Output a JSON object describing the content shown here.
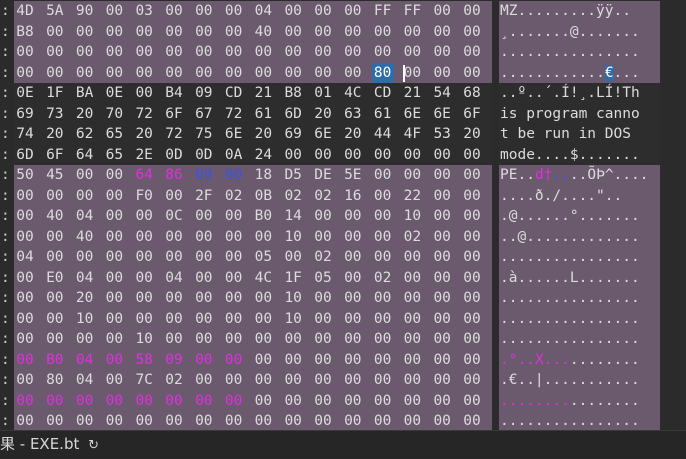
{
  "colors": {
    "header_region": "#6b5a6e",
    "plain_region": "#2d2d2d",
    "dark_text": "#dcdcdc",
    "magenta": "#e02fe0",
    "blue": "#3a52e8",
    "cursor": "#2f6da8",
    "ascii_magenta": "#e02fe0"
  },
  "header_strip": " 0  1  2  3  4  5  6  7  8  9  A  B  C  D  E  F   0123456789ABCDEF",
  "rows": [
    {
      "bytes": [
        "4D",
        "5A",
        "90",
        "00",
        "03",
        "00",
        "00",
        "00",
        "04",
        "00",
        "00",
        "00",
        "FF",
        "FF",
        "00",
        "00"
      ],
      "ascii": "MZ.........ÿÿ..",
      "bg": "struct"
    },
    {
      "bytes": [
        "B8",
        "00",
        "00",
        "00",
        "00",
        "00",
        "00",
        "00",
        "40",
        "00",
        "00",
        "00",
        "00",
        "00",
        "00",
        "00"
      ],
      "ascii": "¸.......@.......",
      "bg": "struct"
    },
    {
      "bytes": [
        "00",
        "00",
        "00",
        "00",
        "00",
        "00",
        "00",
        "00",
        "00",
        "00",
        "00",
        "00",
        "00",
        "00",
        "00",
        "00"
      ],
      "ascii": "................",
      "bg": "struct"
    },
    {
      "bytes": [
        "00",
        "00",
        "00",
        "00",
        "00",
        "00",
        "00",
        "00",
        "00",
        "00",
        "00",
        "00",
        "80",
        "00",
        "00",
        "00"
      ],
      "ascii": "............€...",
      "bg": "struct",
      "cursor_byte": 12
    },
    {
      "bytes": [
        "0E",
        "1F",
        "BA",
        "0E",
        "00",
        "B4",
        "09",
        "CD",
        "21",
        "B8",
        "01",
        "4C",
        "CD",
        "21",
        "54",
        "68"
      ],
      "ascii": "..º..´.Í!¸.LÍ!Th",
      "bg": "plain"
    },
    {
      "bytes": [
        "69",
        "73",
        "20",
        "70",
        "72",
        "6F",
        "67",
        "72",
        "61",
        "6D",
        "20",
        "63",
        "61",
        "6E",
        "6E",
        "6F"
      ],
      "ascii": "is program canno",
      "bg": "plain"
    },
    {
      "bytes": [
        "74",
        "20",
        "62",
        "65",
        "20",
        "72",
        "75",
        "6E",
        "20",
        "69",
        "6E",
        "20",
        "44",
        "4F",
        "53",
        "20"
      ],
      "ascii": "t be run in DOS ",
      "bg": "plain"
    },
    {
      "bytes": [
        "6D",
        "6F",
        "64",
        "65",
        "2E",
        "0D",
        "0D",
        "0A",
        "24",
        "00",
        "00",
        "00",
        "00",
        "00",
        "00",
        "00"
      ],
      "ascii": "mode....$.......",
      "bg": "plain"
    },
    {
      "bytes": [
        "50",
        "45",
        "00",
        "00",
        "64",
        "86",
        "09",
        "00",
        "18",
        "D5",
        "DE",
        "5E",
        "00",
        "00",
        "00",
        "00"
      ],
      "ascii": "PE..d†....ÕÞ^....",
      "bg": "struct",
      "colors": {
        "4": "magenta",
        "5": "magenta",
        "6": "blue",
        "7": "blue"
      },
      "ascii_colors": {
        "4": "magenta",
        "5": "magenta",
        "6": "blue",
        "7": "blue"
      }
    },
    {
      "bytes": [
        "00",
        "00",
        "00",
        "00",
        "F0",
        "00",
        "2F",
        "02",
        "0B",
        "02",
        "02",
        "16",
        "00",
        "22",
        "00",
        "00"
      ],
      "ascii": "....ð./....\"..",
      "bg": "struct"
    },
    {
      "bytes": [
        "00",
        "40",
        "04",
        "00",
        "00",
        "0C",
        "00",
        "00",
        "B0",
        "14",
        "00",
        "00",
        "00",
        "10",
        "00",
        "00"
      ],
      "ascii": ".@......°.......",
      "bg": "struct"
    },
    {
      "bytes": [
        "00",
        "00",
        "40",
        "00",
        "00",
        "00",
        "00",
        "00",
        "00",
        "10",
        "00",
        "00",
        "00",
        "02",
        "00",
        "00"
      ],
      "ascii": "..@.............",
      "bg": "struct"
    },
    {
      "bytes": [
        "04",
        "00",
        "00",
        "00",
        "00",
        "00",
        "00",
        "00",
        "05",
        "00",
        "02",
        "00",
        "00",
        "00",
        "00",
        "00"
      ],
      "ascii": "................",
      "bg": "struct"
    },
    {
      "bytes": [
        "00",
        "E0",
        "04",
        "00",
        "00",
        "04",
        "00",
        "00",
        "4C",
        "1F",
        "05",
        "00",
        "02",
        "00",
        "00",
        "00"
      ],
      "ascii": ".à......L.......",
      "bg": "struct"
    },
    {
      "bytes": [
        "00",
        "00",
        "20",
        "00",
        "00",
        "00",
        "00",
        "00",
        "00",
        "10",
        "00",
        "00",
        "00",
        "00",
        "00",
        "00"
      ],
      "ascii": "................",
      "bg": "struct"
    },
    {
      "bytes": [
        "00",
        "00",
        "10",
        "00",
        "00",
        "00",
        "00",
        "00",
        "00",
        "10",
        "00",
        "00",
        "00",
        "00",
        "00",
        "00"
      ],
      "ascii": "................",
      "bg": "struct"
    },
    {
      "bytes": [
        "00",
        "00",
        "00",
        "00",
        "10",
        "00",
        "00",
        "00",
        "00",
        "00",
        "00",
        "00",
        "00",
        "00",
        "00",
        "00"
      ],
      "ascii": "................",
      "bg": "struct"
    },
    {
      "bytes": [
        "00",
        "B0",
        "04",
        "00",
        "58",
        "09",
        "00",
        "00",
        "00",
        "00",
        "00",
        "00",
        "00",
        "00",
        "00",
        "00"
      ],
      "ascii": ".°..X...........",
      "bg": "struct",
      "colors": {
        "0": "magenta",
        "1": "magenta",
        "2": "magenta",
        "3": "magenta",
        "4": "magenta",
        "5": "magenta",
        "6": "magenta",
        "7": "magenta"
      },
      "ascii_colors": {
        "0": "magenta",
        "1": "magenta",
        "2": "magenta",
        "3": "magenta",
        "4": "magenta",
        "5": "magenta",
        "6": "magenta",
        "7": "magenta"
      }
    },
    {
      "bytes": [
        "00",
        "80",
        "04",
        "00",
        "7C",
        "02",
        "00",
        "00",
        "00",
        "00",
        "00",
        "00",
        "00",
        "00",
        "00",
        "00"
      ],
      "ascii": ".€..|...........",
      "bg": "struct"
    },
    {
      "bytes": [
        "00",
        "00",
        "00",
        "00",
        "00",
        "00",
        "00",
        "00",
        "00",
        "00",
        "00",
        "00",
        "00",
        "00",
        "00",
        "00"
      ],
      "ascii": "................",
      "bg": "struct",
      "colors": {
        "0": "magenta",
        "1": "magenta",
        "2": "magenta",
        "3": "magenta",
        "4": "magenta",
        "5": "magenta",
        "6": "magenta",
        "7": "magenta"
      },
      "ascii_colors": {
        "0": "magenta",
        "1": "magenta",
        "2": "magenta",
        "3": "magenta",
        "4": "magenta",
        "5": "magenta",
        "6": "magenta",
        "7": "magenta"
      }
    },
    {
      "bytes": [
        "00",
        "00",
        "00",
        "00",
        "00",
        "00",
        "00",
        "00",
        "00",
        "00",
        "00",
        "00",
        "00",
        "00",
        "00",
        "00"
      ],
      "ascii": "................",
      "bg": "struct"
    }
  ],
  "status_bar": {
    "label": "果 - EXE.bt",
    "refresh_icon": "refresh-icon"
  }
}
